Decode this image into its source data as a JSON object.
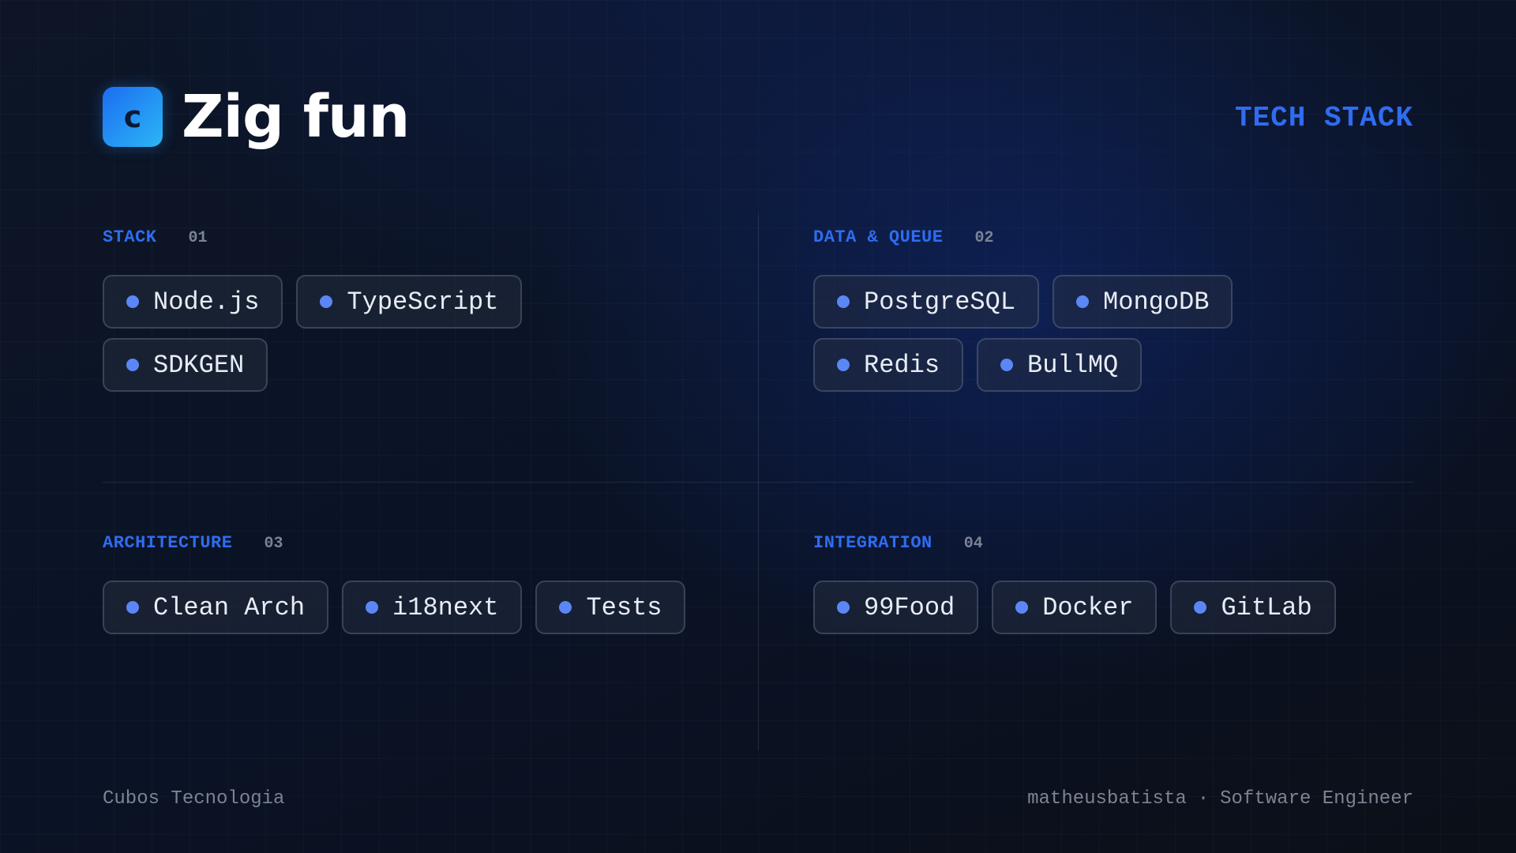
{
  "header": {
    "logo_letter": "c",
    "title": "Zig fun",
    "tag": "TECH STACK"
  },
  "sections": [
    {
      "title": "STACK",
      "number": "01",
      "items": [
        "Node.js",
        "TypeScript",
        "SDKGEN"
      ]
    },
    {
      "title": "DATA & QUEUE",
      "number": "02",
      "items": [
        "PostgreSQL",
        "MongoDB",
        "Redis",
        "BullMQ"
      ]
    },
    {
      "title": "ARCHITECTURE",
      "number": "03",
      "items": [
        "Clean Arch",
        "i18next",
        "Tests"
      ]
    },
    {
      "title": "INTEGRATION",
      "number": "04",
      "items": [
        "99Food",
        "Docker",
        "GitLab"
      ]
    }
  ],
  "footer": {
    "company": "Cubos Tecnologia",
    "author": "matheusbatista",
    "separator": "·",
    "role": "Software Engineer"
  },
  "colors": {
    "accent": "#2f6cf0",
    "dot": "#5b86f5",
    "logo_gradient_start": "#1c6df2",
    "logo_gradient_end": "#2bb6f5",
    "muted_text": "#7c8392"
  }
}
